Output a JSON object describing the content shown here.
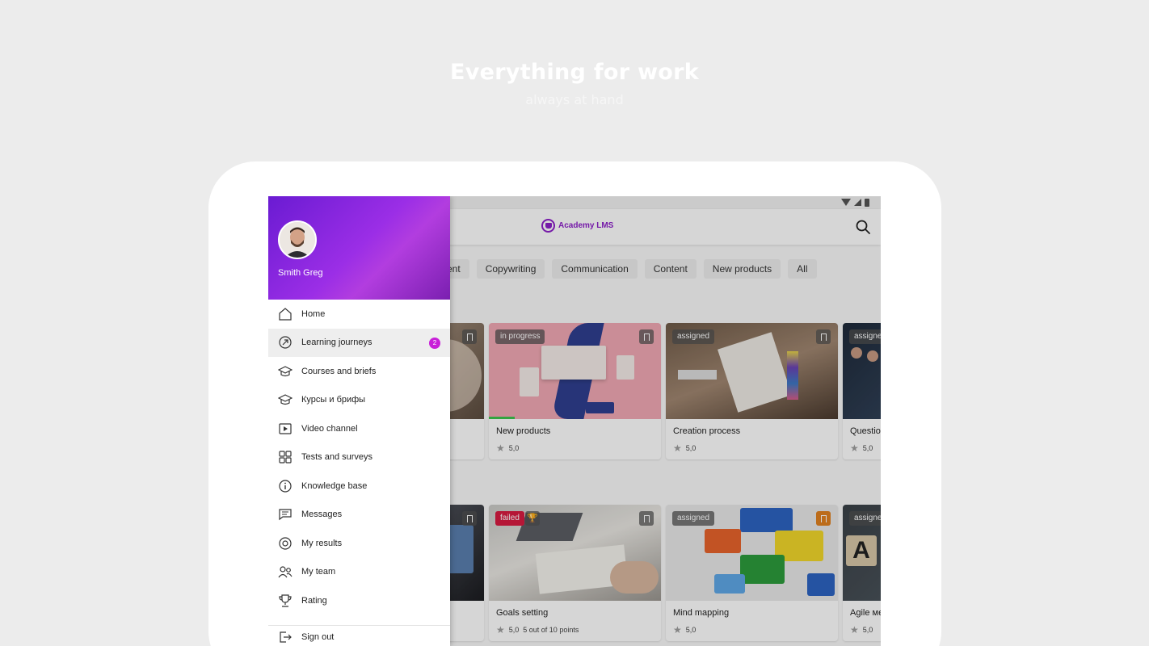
{
  "hero": {
    "title": "Everything for work",
    "subtitle": "always at hand"
  },
  "appbar": {
    "logo_text": "Academy LMS",
    "search_icon": "search-icon"
  },
  "filters": [
    "ent",
    "Copywriting",
    "Communication",
    "Content",
    "New products",
    "All"
  ],
  "section_count": "1",
  "cards": [
    {
      "title": "",
      "rating": "",
      "status": "",
      "image": "hands-on-book"
    },
    {
      "title": "New products",
      "rating": "5,0",
      "status": "in progress",
      "image": "pink-branding",
      "progress": 0.15
    },
    {
      "title": "Creation process",
      "rating": "5,0",
      "status": "assigned",
      "image": "desk-papers"
    },
    {
      "title": "Question",
      "rating": "5,0",
      "status": "assigne",
      "image": "business-people"
    },
    {
      "title": "",
      "rating": "",
      "status": "",
      "image": "laptop-dark"
    },
    {
      "title": "Goals setting",
      "rating": "5,0",
      "rating_extra": "5 out of 10 points",
      "status": "failed",
      "image": "laptop-notes"
    },
    {
      "title": "Mind mapping",
      "rating": "5,0",
      "status": "assigned",
      "image": "lego-bricks"
    },
    {
      "title": "Agile ме",
      "rating": "5,0",
      "status": "assigne",
      "image": "letter-blocks"
    }
  ],
  "drawer": {
    "user_name": "Smith Greg",
    "menu": [
      {
        "label": "Home",
        "icon": "home-icon"
      },
      {
        "label": "Learning journeys",
        "icon": "journey-arrow-icon",
        "count": "2",
        "active": true
      },
      {
        "label": "Courses and briefs",
        "icon": "graduation-cap-icon"
      },
      {
        "label": "Курсы и брифы",
        "icon": "graduation-cap-icon"
      },
      {
        "label": "Video channel",
        "icon": "video-icon"
      },
      {
        "label": "Tests and surveys",
        "icon": "tests-grid-icon"
      },
      {
        "label": "Knowledge base",
        "icon": "info-icon"
      },
      {
        "label": "Messages",
        "icon": "message-icon"
      },
      {
        "label": "My results",
        "icon": "results-icon"
      },
      {
        "label": "My team",
        "icon": "team-icon"
      },
      {
        "label": "Rating",
        "icon": "trophy-icon"
      }
    ],
    "sign_out": {
      "label": "Sign out",
      "icon": "sign-out-icon"
    }
  },
  "colors": {
    "brand": "#8c1fc9",
    "badge_count": "#c81fd8",
    "failed": "#d81b41",
    "progress": "#3cc44d"
  }
}
